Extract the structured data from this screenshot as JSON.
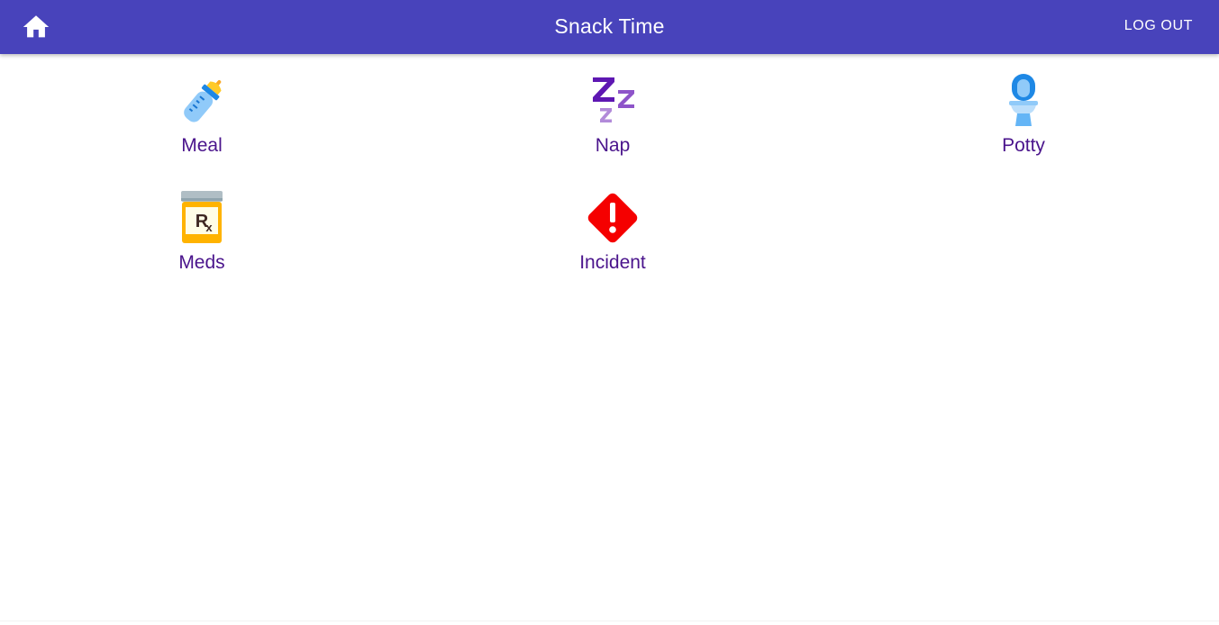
{
  "colors": {
    "appbar": "#4843bb",
    "label": "#4a148c"
  },
  "appbar": {
    "home_icon": "home-icon",
    "title": "Snack Time",
    "logout_label": "LOG OUT"
  },
  "tiles": [
    {
      "label": "Meal",
      "icon": "baby-bottle-icon"
    },
    {
      "label": "Nap",
      "icon": "zzz-sleep-icon"
    },
    {
      "label": "Potty",
      "icon": "toilet-icon"
    },
    {
      "label": "Meds",
      "icon": "pill-bottle-rx-icon"
    },
    {
      "label": "Incident",
      "icon": "warning-diamond-icon"
    }
  ]
}
